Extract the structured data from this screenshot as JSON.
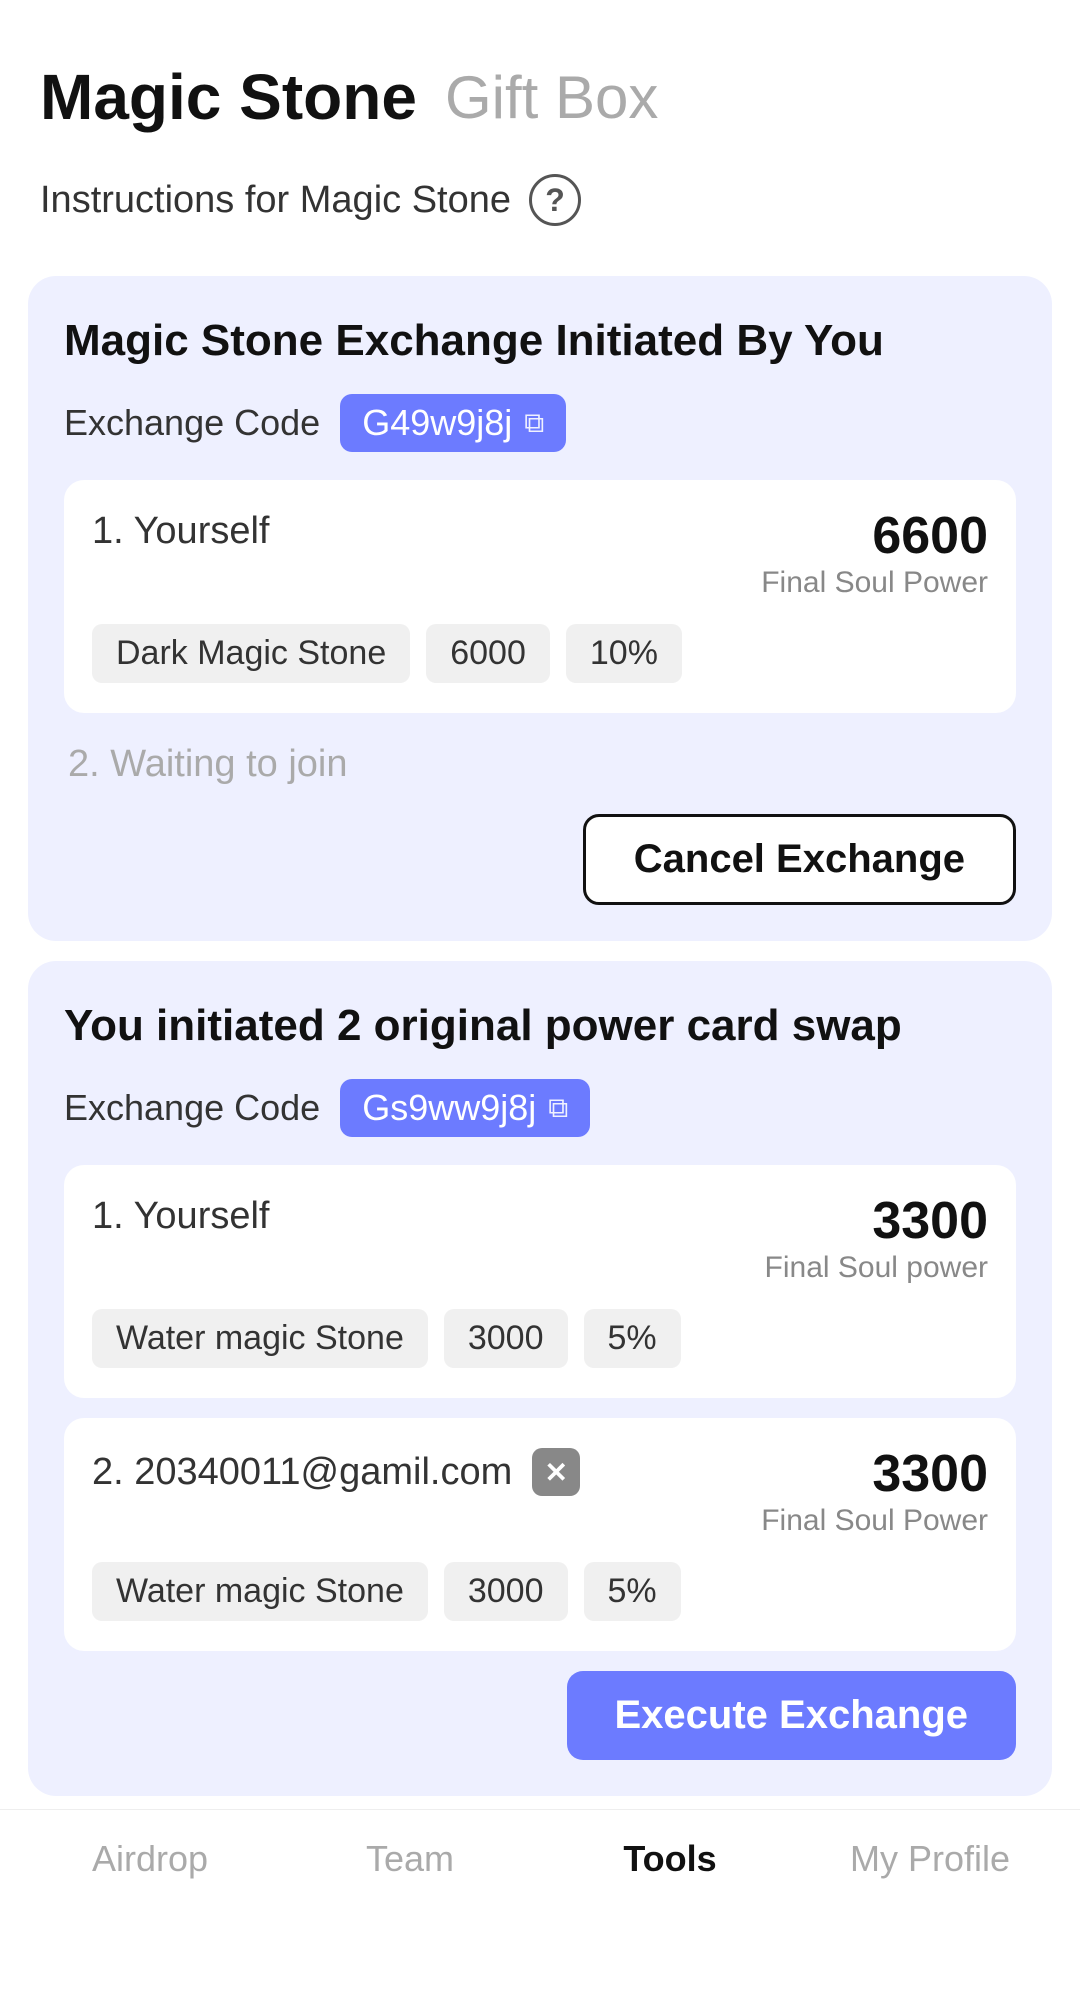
{
  "header": {
    "title": "Magic Stone",
    "subtitle": "Gift Box"
  },
  "instructions": {
    "label": "Instructions for Magic Stone",
    "icon": "?"
  },
  "card1": {
    "title": "Magic Stone Exchange Initiated By You",
    "exchange_code_label": "Exchange Code",
    "exchange_code": "G49w9j8j",
    "participant1": {
      "name": "1. Yourself",
      "soul_power_number": "6600",
      "soul_power_label": "Final Soul Power",
      "tags": [
        "Dark Magic Stone",
        "6000",
        "10%"
      ]
    },
    "participant2": {
      "name": "2. Waiting to join"
    },
    "cancel_btn": "Cancel Exchange"
  },
  "card2": {
    "title": "You initiated 2 original power card swap",
    "exchange_code_label": "Exchange Code",
    "exchange_code": "Gs9ww9j8j",
    "participant1": {
      "name": "1. Yourself",
      "soul_power_number": "3300",
      "soul_power_label": "Final Soul power",
      "tags": [
        "Water magic Stone",
        "3000",
        "5%"
      ]
    },
    "participant2": {
      "name": "2. 20340011@gamil.com",
      "soul_power_number": "3300",
      "soul_power_label": "Final Soul Power",
      "tags": [
        "Water magic Stone",
        "3000",
        "5%"
      ]
    },
    "execute_btn": "Execute Exchange"
  },
  "bottom_nav": {
    "items": [
      {
        "label": "Airdrop",
        "active": false
      },
      {
        "label": "Team",
        "active": false
      },
      {
        "label": "Tools",
        "active": true
      },
      {
        "label": "My Profile",
        "active": false
      }
    ]
  }
}
